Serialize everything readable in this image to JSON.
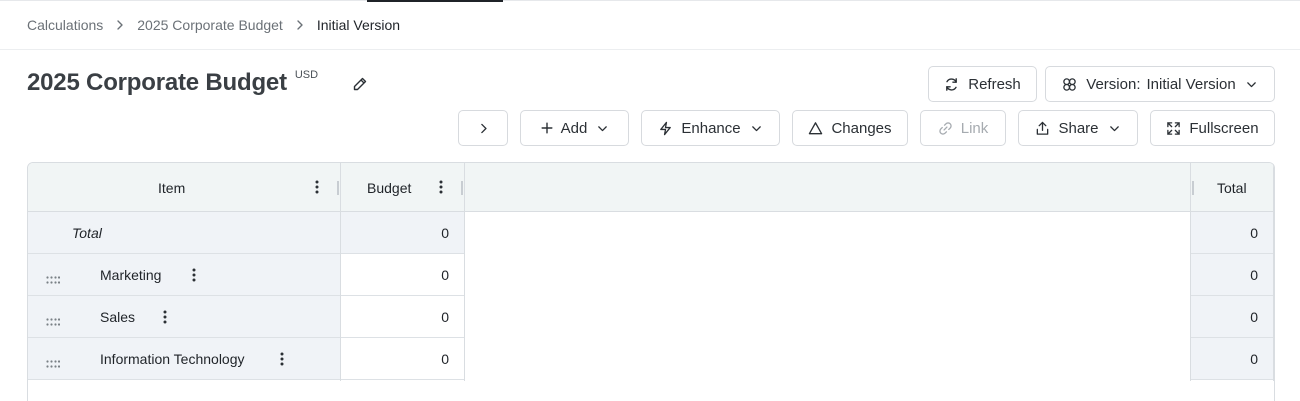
{
  "breadcrumb": [
    {
      "label": "Calculations"
    },
    {
      "label": "2025 Corporate Budget"
    },
    {
      "label": "Initial Version"
    }
  ],
  "page": {
    "title": "2025 Corporate Budget",
    "currency": "USD"
  },
  "toolbar": {
    "refresh_label": "Refresh",
    "version_prefix": "Version:",
    "version_value": "Initial Version",
    "expand_label": "",
    "add_label": "Add",
    "enhance_label": "Enhance",
    "changes_label": "Changes",
    "link_label": "Link",
    "share_label": "Share",
    "fullscreen_label": "Fullscreen"
  },
  "grid": {
    "columns": {
      "item": "Item",
      "budget": "Budget",
      "total": "Total"
    },
    "rows": [
      {
        "item": "Total",
        "budget": "0",
        "total": "0",
        "is_total": true
      },
      {
        "item": "Marketing",
        "budget": "0",
        "total": "0"
      },
      {
        "item": "Sales",
        "budget": "0",
        "total": "0"
      },
      {
        "item": "Information Technology",
        "budget": "0",
        "total": "0"
      }
    ]
  },
  "colors": {
    "header_bg": "#f1f5f5",
    "total_row_bg": "#f0f3f7",
    "border": "#d9dde1",
    "text": "#1f2328",
    "muted_text": "#6b7177"
  }
}
